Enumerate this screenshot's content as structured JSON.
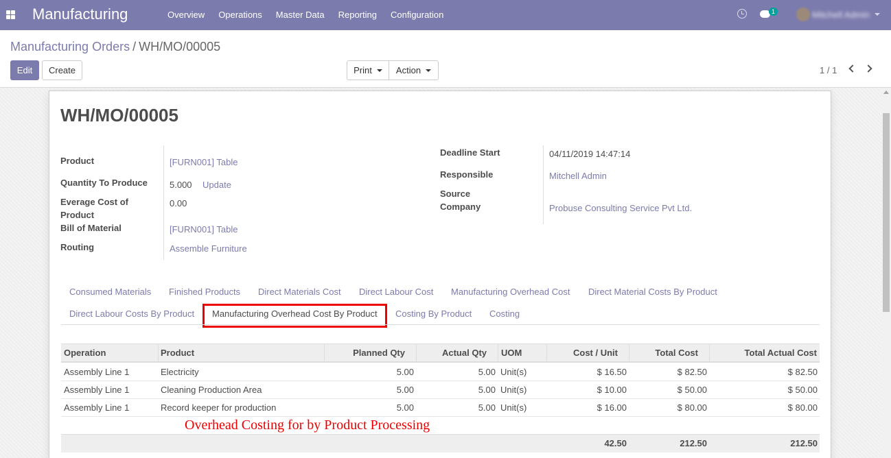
{
  "navbar": {
    "brand": "Manufacturing",
    "menu": [
      "Overview",
      "Operations",
      "Master Data",
      "Reporting",
      "Configuration"
    ],
    "chat_count": "1",
    "user_name": "Mitchell Admin"
  },
  "breadcrumb": {
    "parent": "Manufacturing Orders",
    "separator": "/",
    "current": "WH/MO/00005"
  },
  "toolbar": {
    "edit": "Edit",
    "create": "Create",
    "print": "Print",
    "action": "Action"
  },
  "pager": {
    "text": "1 / 1"
  },
  "record": {
    "title": "WH/MO/00005",
    "left_fields": {
      "product": {
        "label": "Product",
        "value": "[FURN001] Table"
      },
      "qty": {
        "label": "Quantity To Produce",
        "value": "5.000",
        "action": "Update"
      },
      "avg_cost": {
        "label_line1": "Everage Cost of",
        "label_line2": "Product",
        "value": "0.00"
      },
      "bom": {
        "label": "Bill of Material",
        "value": "[FURN001] Table"
      },
      "routing": {
        "label": "Routing",
        "value": "Assemble Furniture"
      }
    },
    "right_fields": {
      "deadline": {
        "label": "Deadline Start",
        "value": "04/11/2019 14:47:14"
      },
      "responsible": {
        "label": "Responsible",
        "value": "Mitchell Admin"
      },
      "company": {
        "label_line1": "Source",
        "label_line2": "Company",
        "value": "Probuse Consulting Service Pvt Ltd."
      }
    }
  },
  "tabs": {
    "row1": [
      "Consumed Materials",
      "Finished Products",
      "Direct Materials Cost",
      "Direct Labour Cost",
      "Manufacturing Overhead Cost",
      "Direct Material Costs By Product"
    ],
    "row2": [
      "Direct Labour Costs By Product",
      "Manufacturing Overhead Cost By Product",
      "Costing By Product",
      "Costing"
    ],
    "active": "Manufacturing Overhead Cost By Product"
  },
  "table": {
    "headers": [
      "Operation",
      "Product",
      "Planned Qty",
      "Actual Qty",
      "UOM",
      "Cost / Unit",
      "Total Cost",
      "Total Actual Cost"
    ],
    "rows": [
      [
        "Assembly Line 1",
        "Electricity",
        "5.00",
        "5.00",
        "Unit(s)",
        "$ 16.50",
        "$ 82.50",
        "$ 82.50"
      ],
      [
        "Assembly Line 1",
        "Cleaning Production Area",
        "5.00",
        "5.00",
        "Unit(s)",
        "$ 10.00",
        "$ 50.00",
        "$ 50.00"
      ],
      [
        "Assembly Line 1",
        "Record keeper for production",
        "5.00",
        "5.00",
        "Unit(s)",
        "$ 16.00",
        "$ 80.00",
        "$ 80.00"
      ]
    ],
    "totals": {
      "cost_unit": "42.50",
      "total_cost": "212.50",
      "total_actual_cost": "212.50"
    }
  },
  "annotation": "Overhead  Costing for by Product  Processing",
  "colors": {
    "navbar": "#7c7bad",
    "link": "#7c7bad",
    "highlight": "#ee0000"
  }
}
